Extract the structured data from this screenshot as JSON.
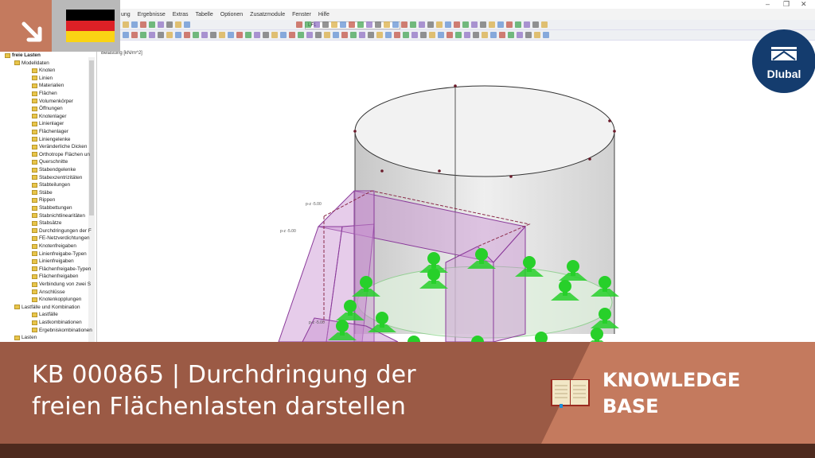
{
  "menu": [
    "ung",
    "Ergebnisse",
    "Extras",
    "Tabelle",
    "Optionen",
    "Zusatzmodule",
    "Fenster",
    "Hilfe"
  ],
  "toolbar": {
    "load_case": "LF1"
  },
  "viewport": {
    "label": "Belastung [kN/m^2]",
    "load_tags": [
      "p-z -5.00",
      "p-z -5.00",
      "p-z -5.00"
    ]
  },
  "tree": {
    "items": [
      {
        "label": "freie Lasten",
        "level": 0,
        "bold": true
      },
      {
        "label": "Modelldaten",
        "level": 1
      },
      {
        "label": "Knoten",
        "level": 2
      },
      {
        "label": "Linien",
        "level": 2
      },
      {
        "label": "Materialien",
        "level": 2
      },
      {
        "label": "Flächen",
        "level": 2
      },
      {
        "label": "Volumenkörper",
        "level": 2
      },
      {
        "label": "Öffnungen",
        "level": 2
      },
      {
        "label": "Knotenlager",
        "level": 2
      },
      {
        "label": "Linienlager",
        "level": 2
      },
      {
        "label": "Flächenlager",
        "level": 2
      },
      {
        "label": "Liniengelenke",
        "level": 2
      },
      {
        "label": "Veränderliche Dicken",
        "level": 2
      },
      {
        "label": "Orthotrope Flächen un",
        "level": 2
      },
      {
        "label": "Querschnitte",
        "level": 2
      },
      {
        "label": "Stabendgelenke",
        "level": 2
      },
      {
        "label": "Stabexzentrizitäten",
        "level": 2
      },
      {
        "label": "Stabteilungen",
        "level": 2
      },
      {
        "label": "Stäbe",
        "level": 2
      },
      {
        "label": "Rippen",
        "level": 2
      },
      {
        "label": "Stabbettungen",
        "level": 2
      },
      {
        "label": "Stabnichtlinearitäten",
        "level": 2
      },
      {
        "label": "Stabsätze",
        "level": 2
      },
      {
        "label": "Durchdringungen der F",
        "level": 2
      },
      {
        "label": "FE-Netzverdichtungen",
        "level": 2
      },
      {
        "label": "Knotenfreigaben",
        "level": 2
      },
      {
        "label": "Linienfreigabe-Typen",
        "level": 2
      },
      {
        "label": "Linienfreigaben",
        "level": 2
      },
      {
        "label": "Flächenfreigabe-Typen",
        "level": 2
      },
      {
        "label": "Flächenfreigaben",
        "level": 2
      },
      {
        "label": "Verbindung von zwei S",
        "level": 2
      },
      {
        "label": "Anschlüsse",
        "level": 2
      },
      {
        "label": "Knotenkopplungen",
        "level": 2
      },
      {
        "label": "Lastfälle und Kombination",
        "level": 1
      },
      {
        "label": "Lastfälle",
        "level": 2
      },
      {
        "label": "Lastkombinationen",
        "level": 2
      },
      {
        "label": "Ergebniskombinationen",
        "level": 2
      },
      {
        "label": "Lasten",
        "level": 1
      }
    ]
  },
  "brand": {
    "logo": "Dlubal",
    "colors": {
      "accent": "#c47a5e",
      "dark": "#9b5a45",
      "navy": "#143c6e"
    }
  },
  "banner": {
    "title_line1": "KB 000865 | Durchdringung der",
    "title_line2": "freien Flächenlasten darstellen",
    "kb_line1": "KNOWLEDGE",
    "kb_line2": "BASE"
  }
}
